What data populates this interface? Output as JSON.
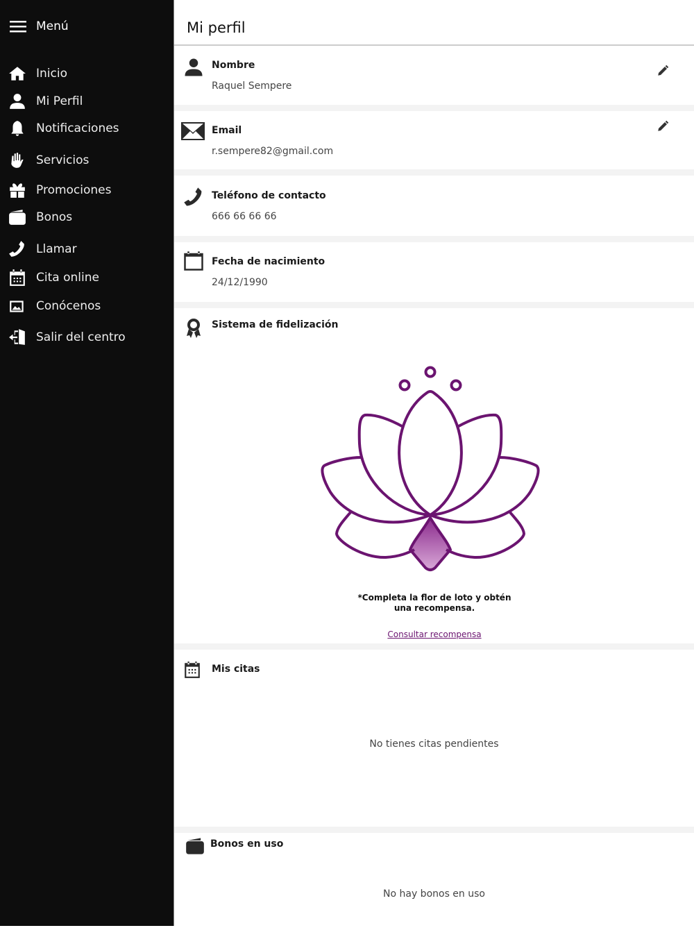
{
  "sidebar": {
    "title": "Menú",
    "items": [
      {
        "label": "Inicio",
        "icon": "home-icon"
      },
      {
        "label": "Mi Perfil",
        "icon": "user-icon"
      },
      {
        "label": "Notificaciones",
        "icon": "bell-icon"
      },
      {
        "label": "Servicios",
        "icon": "hand-icon"
      },
      {
        "label": "Promociones",
        "icon": "gift-icon"
      },
      {
        "label": "Bonos",
        "icon": "wallet-icon"
      },
      {
        "label": "Llamar",
        "icon": "phone-icon"
      },
      {
        "label": "Cita online",
        "icon": "calendar-icon"
      },
      {
        "label": "Conócenos",
        "icon": "images-icon"
      },
      {
        "label": "Salir del centro",
        "icon": "exit-icon"
      }
    ]
  },
  "header": {
    "title": "Mi perfil"
  },
  "profile": {
    "name": {
      "label": "Nombre",
      "value": "Raquel Sempere"
    },
    "email": {
      "label": "Email",
      "value": "r.sempere82@gmail.com"
    },
    "phone": {
      "label": "Teléfono de contacto",
      "value": "666 66 66 66"
    },
    "birth": {
      "label": "Fecha de nacimiento",
      "value": "24/12/1990"
    }
  },
  "loyalty": {
    "label": "Sistema de fidelización",
    "note": "*Completa la flor de loto y obtén una recompensa.",
    "link": "Consultar recompensa",
    "accent": "#6b1470"
  },
  "appointments": {
    "label": "Mis citas",
    "empty": "No tienes citas pendientes"
  },
  "vouchers": {
    "label": "Bonos en uso",
    "empty": "No hay bonos en uso"
  }
}
